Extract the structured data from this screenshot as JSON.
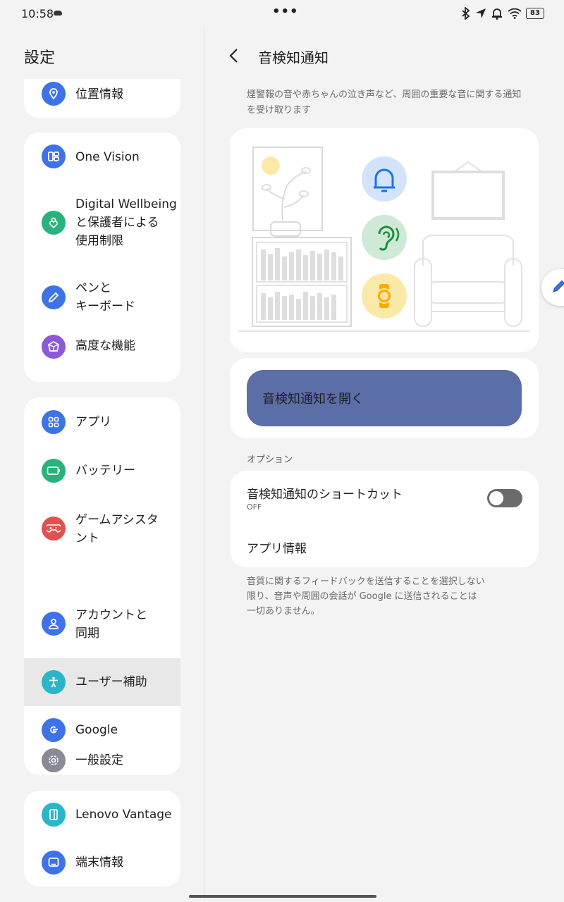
{
  "status_bar": {
    "time": "10:58",
    "dots": "•••",
    "battery": "83"
  },
  "left": {
    "title": "設定",
    "cards": [
      {
        "items": [
          {
            "label": "位置情報",
            "icon": "location-icon",
            "color": "#3d73e6"
          }
        ]
      },
      {
        "items": [
          {
            "label": "One Vision",
            "icon": "one-vision-icon",
            "color": "#3d73e6"
          },
          {
            "label": "Digital Wellbeing\nと保護者による\n使用制限",
            "icon": "wellbeing-icon",
            "color": "#27b37a"
          },
          {
            "label": "ペンと\nキーボード",
            "icon": "pen-icon",
            "color": "#3d73e6"
          },
          {
            "label": "高度な機能",
            "icon": "advanced-features-icon",
            "color": "#8c5ad8"
          }
        ]
      },
      {
        "items": [
          {
            "label": "アプリ",
            "icon": "apps-icon",
            "color": "#3d73e6"
          },
          {
            "label": "バッテリー",
            "icon": "battery-icon",
            "color": "#27b37a"
          },
          {
            "label": "ゲームアシスタ\nント",
            "icon": "gamepad-icon",
            "color": "#e25050"
          },
          {
            "label": "アカウントと\n同期",
            "icon": "account-icon",
            "color": "#3d73e6"
          },
          {
            "label": "ユーザー補助",
            "icon": "accessibility-icon",
            "color": "#2bb5c8",
            "active": true
          },
          {
            "label": "Google",
            "icon": "google-icon",
            "color": "#3d73e6"
          },
          {
            "label": "一般設定",
            "icon": "gear-icon",
            "color": "#8a8a96"
          }
        ]
      },
      {
        "items": [
          {
            "label": "Lenovo Vantage",
            "icon": "vantage-icon",
            "color": "#2bb5c8"
          },
          {
            "label": "端末情報",
            "icon": "device-info-icon",
            "color": "#3d73e6"
          }
        ]
      }
    ]
  },
  "right": {
    "title": "音検知通知",
    "description": "煙警報の音や赤ちゃんの泣き声など、周囲の重要な音に関する通知を受け取ります",
    "open_button": "音検知通知を開く",
    "options_header": "オプション",
    "shortcut_title": "音検知通知のショートカット",
    "shortcut_state": "OFF",
    "app_info": "アプリ情報",
    "footer_note": "音質に関するフィードバックを送信することを選択しない\n限り、音声や周囲の会話が Google に送信されることは\n一切ありません。"
  },
  "colors": {
    "accent_button": "#5c6ea8",
    "bell_bg": "#d3e3fb",
    "ear_bg": "#cfe9d6",
    "watch_bg": "#fbe9a8"
  }
}
